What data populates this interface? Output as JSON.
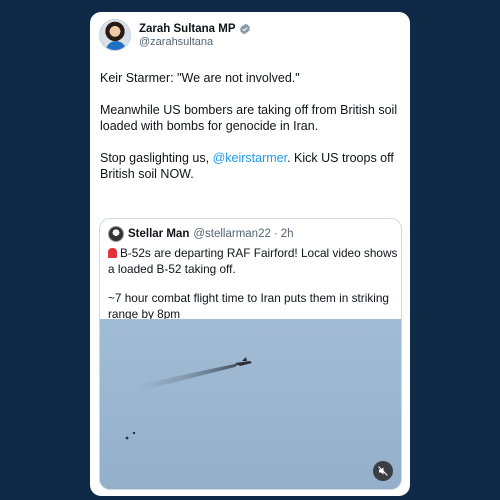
{
  "tweet": {
    "display_name": "Zarah Sultana MP",
    "handle": "@zarahsultana",
    "paragraphs": {
      "p1": "Keir Starmer: \"We are not involved.\"",
      "p2": "Meanwhile US bombers are taking off from British soil loaded with bombs for genocide in Iran.",
      "p3_before": "Stop gaslighting us, ",
      "p3_mention": "@keirstarmer",
      "p3_after": ". Kick US troops off British soil NOW."
    }
  },
  "quote": {
    "display_name": "Stellar Man",
    "handle": "@stellarman22",
    "separator": "·",
    "time": "2h",
    "line1": "B-52s are departing RAF Fairford! Local video shows a loaded B-52 taking off.",
    "line2": "~7 hour combat flight time to Iran puts them in striking range by 8pm"
  },
  "icons": {
    "verified": "verified-badge-icon",
    "siren": "siren-emoji-icon",
    "mute": "mute-icon"
  },
  "colors": {
    "background": "#0e2a47",
    "mention": "#1d9bf0",
    "verified": "#829aab",
    "sky": "#9bb5cf"
  }
}
